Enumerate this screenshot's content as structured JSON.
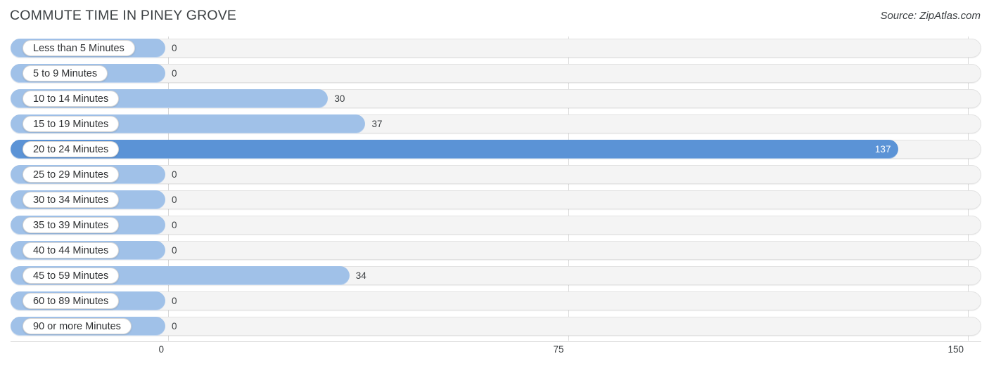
{
  "header": {
    "title": "COMMUTE TIME IN PINEY GROVE",
    "source": "Source: ZipAtlas.com"
  },
  "chart_data": {
    "type": "bar",
    "orientation": "horizontal",
    "title": "COMMUTE TIME IN PINEY GROVE",
    "xlabel": "",
    "ylabel": "",
    "xlim": [
      0,
      150
    ],
    "xticks": [
      0,
      75,
      150
    ],
    "xtick_labels": [
      "0",
      "75",
      "150"
    ],
    "grid": true,
    "legend": null,
    "colors": {
      "bar": "#a0c1e8",
      "bar_highlight": "#5b93d6",
      "track": "#f4f4f4",
      "track_border": "#e2e2e2",
      "gridline": "#d8d8d8",
      "text": "#3c4043",
      "value_text_on_bar": "#ffffff"
    },
    "categories": [
      "Less than 5 Minutes",
      "5 to 9 Minutes",
      "10 to 14 Minutes",
      "15 to 19 Minutes",
      "20 to 24 Minutes",
      "25 to 29 Minutes",
      "30 to 34 Minutes",
      "35 to 39 Minutes",
      "40 to 44 Minutes",
      "45 to 59 Minutes",
      "60 to 89 Minutes",
      "90 or more Minutes"
    ],
    "values": [
      0,
      0,
      30,
      37,
      137,
      0,
      0,
      0,
      0,
      34,
      0,
      0
    ],
    "value_labels": [
      "0",
      "0",
      "30",
      "37",
      "137",
      "0",
      "0",
      "0",
      "0",
      "34",
      "0",
      "0"
    ],
    "highlight_index": 4
  },
  "rows": [
    {
      "label": "Less than 5 Minutes",
      "value": 0,
      "value_label": "0",
      "highlight": false
    },
    {
      "label": "5 to 9 Minutes",
      "value": 0,
      "value_label": "0",
      "highlight": false
    },
    {
      "label": "10 to 14 Minutes",
      "value": 30,
      "value_label": "30",
      "highlight": false
    },
    {
      "label": "15 to 19 Minutes",
      "value": 37,
      "value_label": "37",
      "highlight": false
    },
    {
      "label": "20 to 24 Minutes",
      "value": 137,
      "value_label": "137",
      "highlight": true
    },
    {
      "label": "25 to 29 Minutes",
      "value": 0,
      "value_label": "0",
      "highlight": false
    },
    {
      "label": "30 to 34 Minutes",
      "value": 0,
      "value_label": "0",
      "highlight": false
    },
    {
      "label": "35 to 39 Minutes",
      "value": 0,
      "value_label": "0",
      "highlight": false
    },
    {
      "label": "40 to 44 Minutes",
      "value": 0,
      "value_label": "0",
      "highlight": false
    },
    {
      "label": "45 to 59 Minutes",
      "value": 34,
      "value_label": "34",
      "highlight": false
    },
    {
      "label": "60 to 89 Minutes",
      "value": 0,
      "value_label": "0",
      "highlight": false
    },
    {
      "label": "90 or more Minutes",
      "value": 0,
      "value_label": "0",
      "highlight": false
    }
  ],
  "axis": {
    "ticks": [
      {
        "label": "0",
        "value": 0
      },
      {
        "label": "75",
        "value": 75
      },
      {
        "label": "150",
        "value": 150
      }
    ]
  }
}
